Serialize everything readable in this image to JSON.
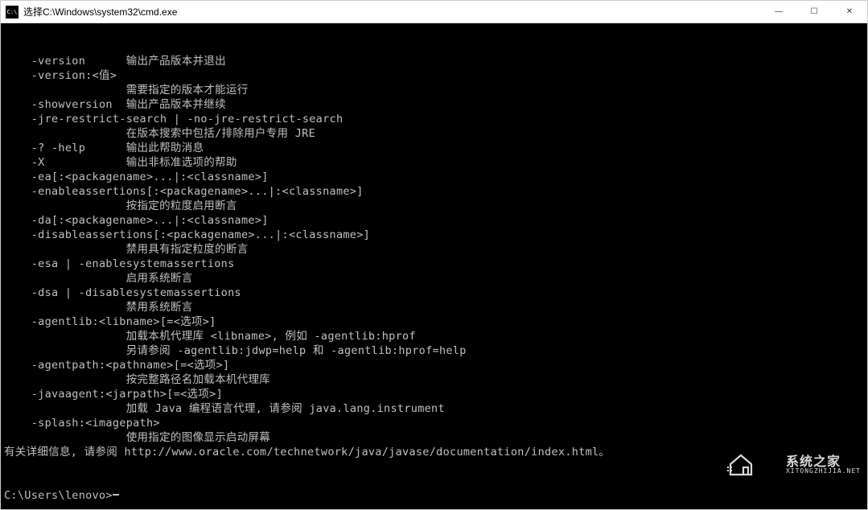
{
  "window": {
    "icon_label": "C:\\",
    "title": "选择C:\\Windows\\system32\\cmd.exe"
  },
  "controls": {
    "minimize": "—",
    "maximize": "☐",
    "close": "✕"
  },
  "terminal": {
    "lines": [
      "    -version      输出产品版本并退出",
      "    -version:<值>",
      "                  需要指定的版本才能运行",
      "    -showversion  输出产品版本并继续",
      "    -jre-restrict-search | -no-jre-restrict-search",
      "                  在版本搜索中包括/排除用户专用 JRE",
      "    -? -help      输出此帮助消息",
      "    -X            输出非标准选项的帮助",
      "    -ea[:<packagename>...|:<classname>]",
      "    -enableassertions[:<packagename>...|:<classname>]",
      "                  按指定的粒度启用断言",
      "    -da[:<packagename>...|:<classname>]",
      "    -disableassertions[:<packagename>...|:<classname>]",
      "                  禁用具有指定粒度的断言",
      "    -esa | -enablesystemassertions",
      "                  启用系统断言",
      "    -dsa | -disablesystemassertions",
      "                  禁用系统断言",
      "    -agentlib:<libname>[=<选项>]",
      "                  加载本机代理库 <libname>, 例如 -agentlib:hprof",
      "                  另请参阅 -agentlib:jdwp=help 和 -agentlib:hprof=help",
      "    -agentpath:<pathname>[=<选项>]",
      "                  按完整路径名加载本机代理库",
      "    -javaagent:<jarpath>[=<选项>]",
      "                  加载 Java 编程语言代理, 请参阅 java.lang.instrument",
      "    -splash:<imagepath>",
      "                  使用指定的图像显示启动屏幕",
      "有关详细信息, 请参阅 http://www.oracle.com/technetwork/java/javase/documentation/index.html。",
      ""
    ],
    "prompt": "C:\\Users\\lenovo>"
  },
  "watermark": {
    "main": "系统之家",
    "sub": "XITONGZHIJIA.NET"
  }
}
